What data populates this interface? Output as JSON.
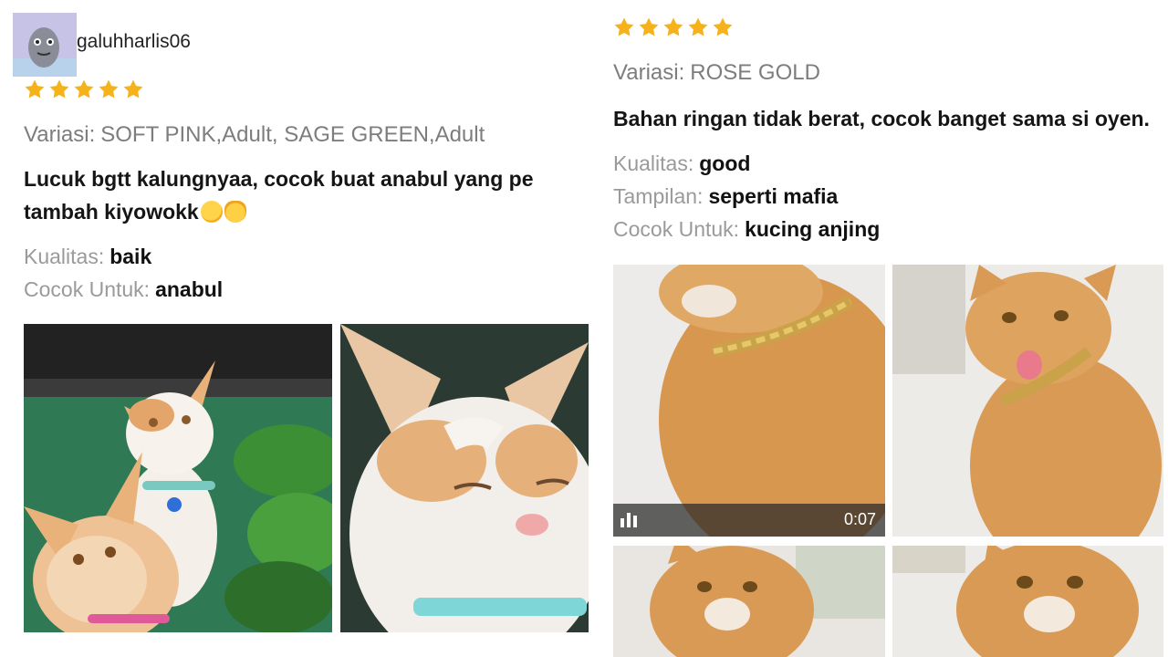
{
  "left_review": {
    "username": "galuhharlis06",
    "rating": 5,
    "variation_label": "Variasi:",
    "variation_value": "SOFT PINK,Adult, SAGE GREEN,Adult",
    "comment_line1": "Lucuk bgtt kalungnyaa, cocok buat anabul yang pe",
    "comment_line2": "tambah kiyowokk",
    "attributes": [
      {
        "label": "Kualitas:",
        "value": "baik"
      },
      {
        "label": "Cocok Untuk:",
        "value": "anabul"
      }
    ]
  },
  "right_review": {
    "rating": 5,
    "variation_label": "Variasi:",
    "variation_value": "ROSE GOLD",
    "comment": "Bahan ringan tidak berat, cocok banget sama si oyen.",
    "attributes": [
      {
        "label": "Kualitas:",
        "value": "good"
      },
      {
        "label": "Tampilan:",
        "value": "seperti mafia"
      },
      {
        "label": "Cocok Untuk:",
        "value": "kucing anjing"
      }
    ],
    "video_duration": "0:07"
  },
  "colors": {
    "star": "#f6b21a",
    "label_gray": "#9a9a9a",
    "variation_gray": "#7d7d7d"
  }
}
